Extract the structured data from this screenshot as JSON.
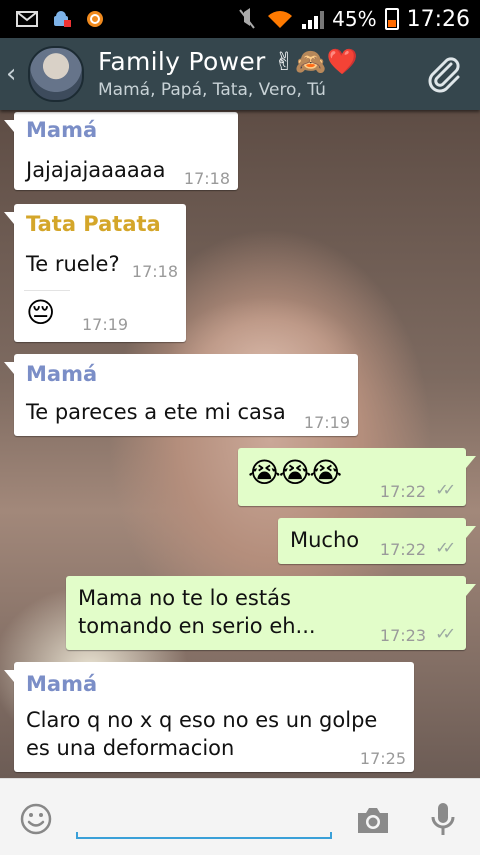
{
  "status_bar": {
    "battery": "45%",
    "time": "17:26",
    "icons": [
      "gmail-icon",
      "android-upload-icon",
      "avast-icon",
      "mute-icon",
      "wifi-icon",
      "signal-icon",
      "battery-icon"
    ]
  },
  "header": {
    "back": "‹",
    "title": "Family Power ✌🙈❤️",
    "subtitle": "Mamá, Papá, Tata, Vero, Tú"
  },
  "messages": [
    {
      "sender": "Mamá",
      "text": "Jajajajaaaaaa",
      "time": "17:18"
    },
    {
      "sender": "Tata Patata",
      "text": "Te ruele?",
      "time": "17:18",
      "emoji": "😔",
      "emoji_time": "17:19"
    },
    {
      "sender": "Mamá",
      "text": "Te pareces a ete mi casa",
      "time": "17:19"
    },
    {
      "text": "😭😭😭",
      "time": "17:22"
    },
    {
      "text": "Mucho",
      "time": "17:22"
    },
    {
      "text": "Mama no te lo estás tomando en serio eh...",
      "time": "17:23"
    },
    {
      "sender": "Mamá",
      "text": "Claro q no x q eso no es un golpe es una deformacion",
      "time": "17:25"
    }
  ],
  "colors": {
    "header_bg": "#35464d",
    "sender_mama": "#7b8ec7",
    "sender_tata": "#d4a62a",
    "outgoing_bubble": "#e2fdc9",
    "input_accent": "#3aa0d8"
  },
  "composer": {
    "value": "",
    "placeholder": ""
  }
}
